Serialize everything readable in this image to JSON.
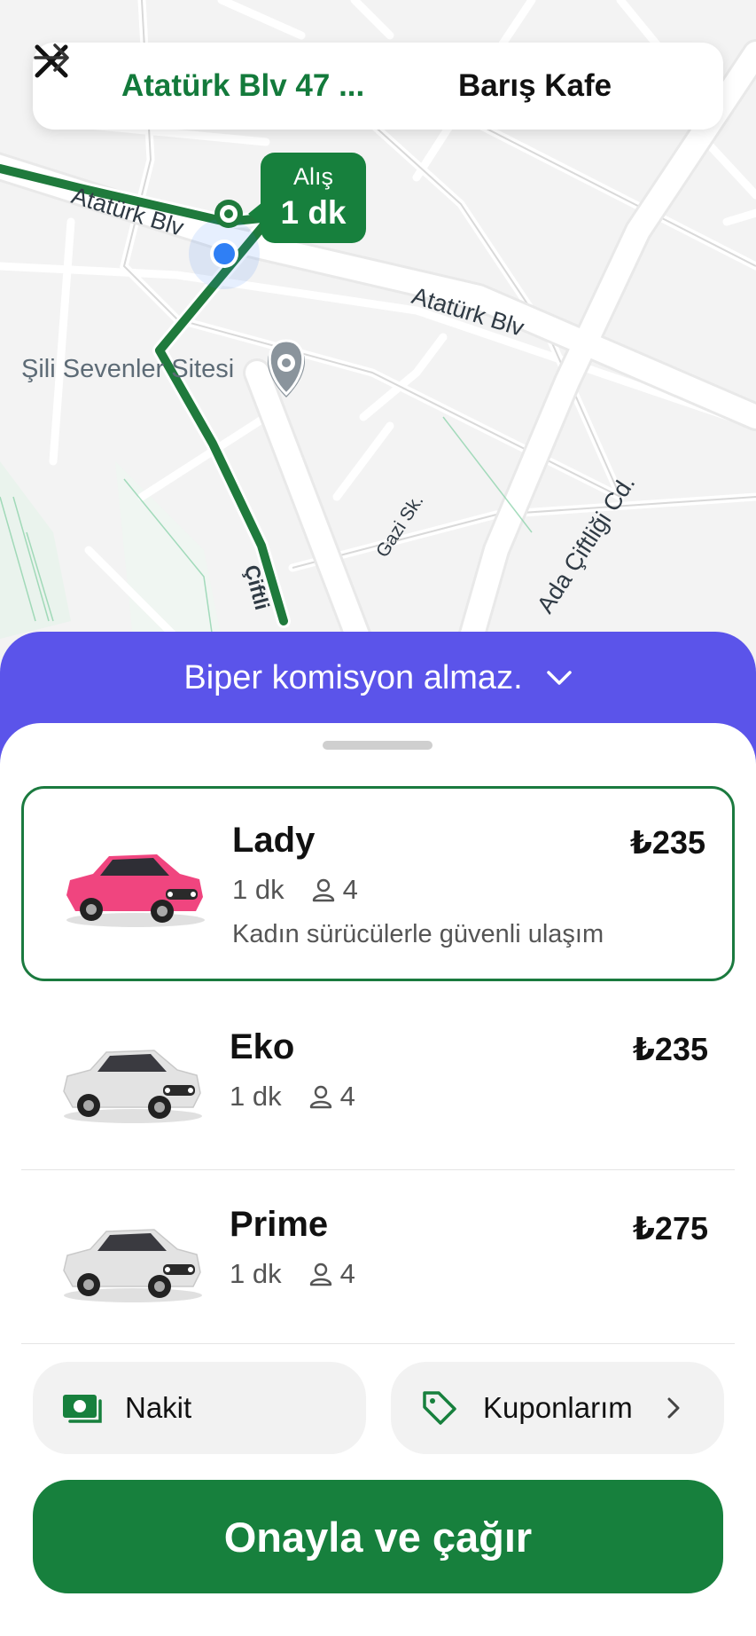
{
  "route": {
    "origin": "Atatürk Blv 47 ...",
    "destination": "Barış Kafe"
  },
  "map": {
    "pickup_label": "Alış",
    "pickup_eta": "1 dk",
    "streets": {
      "ataturk_1": "Atatürk Blv",
      "ataturk_2": "Atatürk Blv",
      "poi": "Şili Sevenler Sitesi",
      "gazi": "Gazi Sk.",
      "ada": "Ada Çiftliği Cd.",
      "ciftlik": "Çiftli"
    }
  },
  "banner": {
    "text": "Biper komisyon almaz."
  },
  "options": [
    {
      "name": "Lady",
      "eta": "1 dk",
      "seats": "4",
      "price": "₺235",
      "description": "Kadın sürücülerle güvenli ulaşım",
      "car_color": "#f0457f",
      "selected": true
    },
    {
      "name": "Eko",
      "eta": "1 dk",
      "seats": "4",
      "price": "₺235",
      "car_color": "#e3e3e3"
    },
    {
      "name": "Prime",
      "eta": "1 dk",
      "seats": "4",
      "price": "₺275",
      "car_color": "#e3e3e3"
    }
  ],
  "payment": {
    "label": "Nakit"
  },
  "coupons": {
    "label": "Kuponlarım"
  },
  "confirm": {
    "label": "Onayla ve çağır"
  },
  "colors": {
    "brand_green": "#17803d",
    "banner_purple": "#5b54ea",
    "location_blue": "#2f7ff5"
  }
}
